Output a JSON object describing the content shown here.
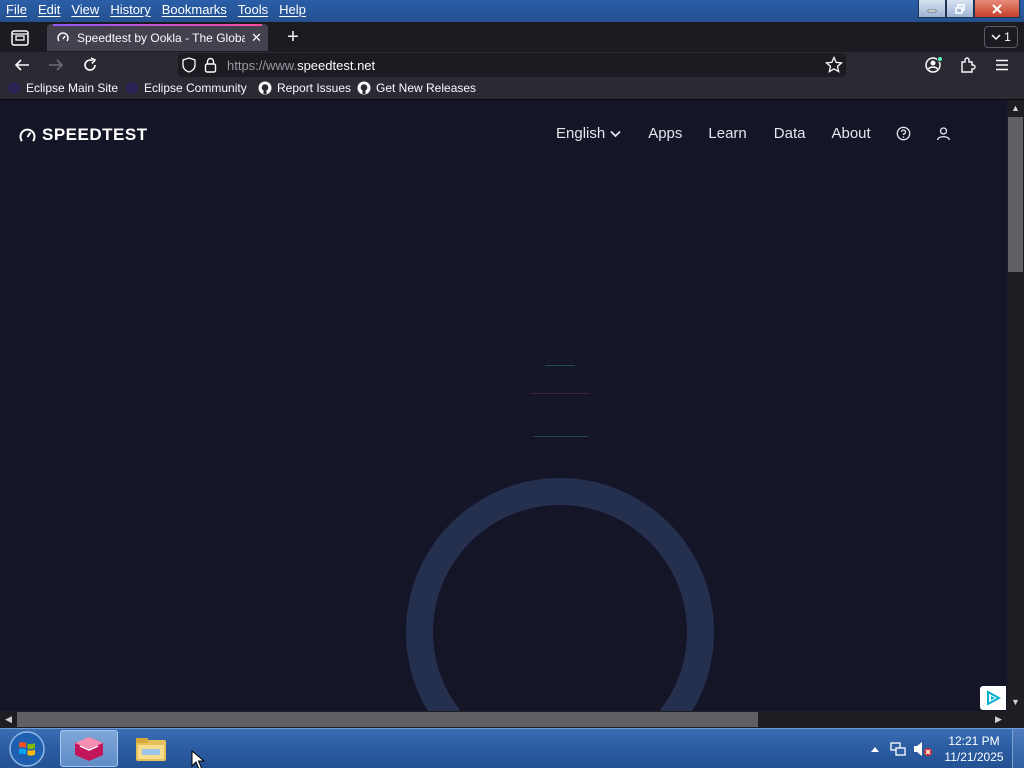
{
  "window": {
    "menu": [
      "File",
      "Edit",
      "View",
      "History",
      "Bookmarks",
      "Tools",
      "Help"
    ]
  },
  "tabs": {
    "active_title": "Speedtest by Ookla - The Globa",
    "count": "1"
  },
  "address_bar": {
    "url_prefix": "https://www.",
    "url_domain": "speedtest.net"
  },
  "bookmarks": [
    {
      "label": "Eclipse Main Site",
      "icon": "eclipse-icon"
    },
    {
      "label": "Eclipse Community",
      "icon": "eclipse-icon"
    },
    {
      "label": "Report Issues",
      "icon": "github-icon"
    },
    {
      "label": "Get New Releases",
      "icon": "github-icon"
    }
  ],
  "site": {
    "logo": "SPEEDTEST",
    "nav": {
      "language": "English",
      "apps": "Apps",
      "learn": "Learn",
      "data": "Data",
      "about": "About"
    }
  },
  "taskbar": {
    "time": "12:21 PM",
    "date": "11/21/2025"
  },
  "colors": {
    "page_bg": "#141526",
    "gauge_ring": "#25304f",
    "tab_accent": "#9059ff",
    "taskbar": "#2d5fa5"
  }
}
